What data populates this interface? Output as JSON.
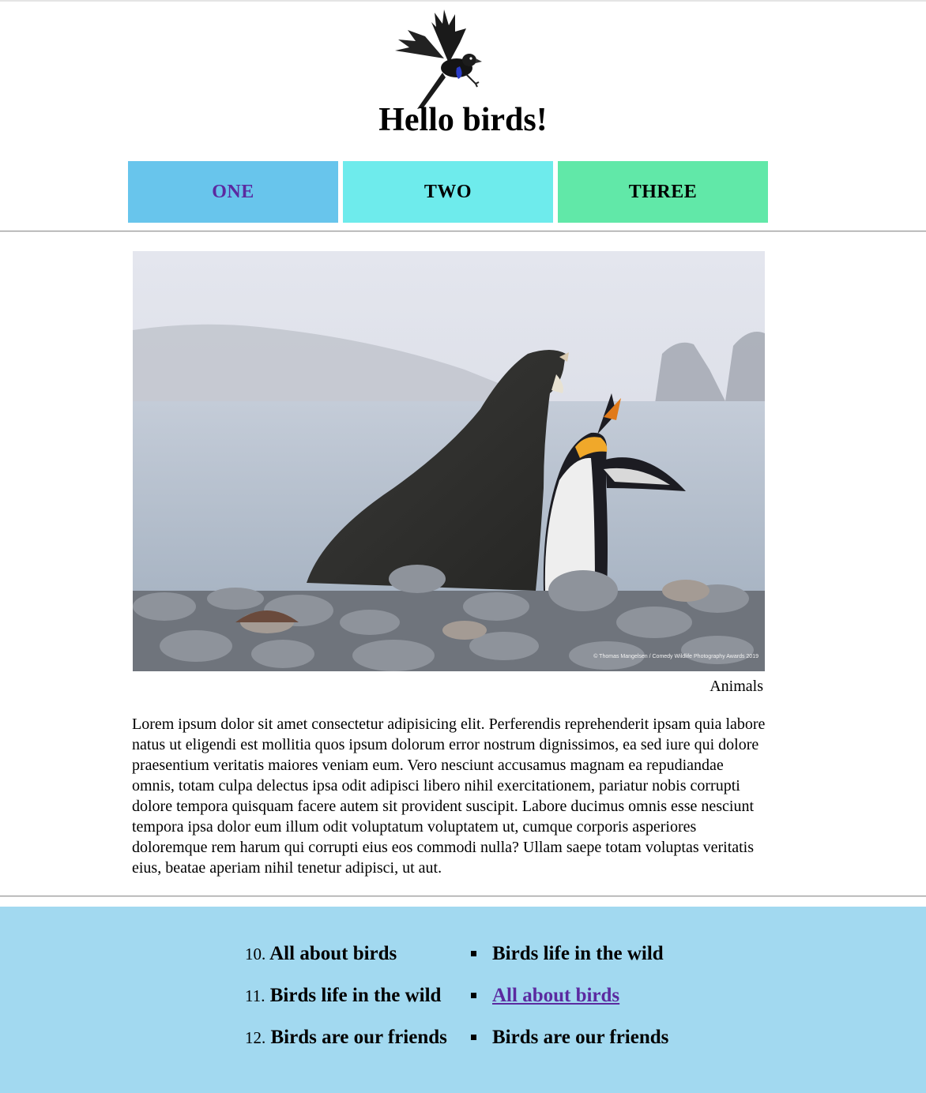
{
  "header": {
    "title": "Hello birds!",
    "logo_icon": "flying-bird-logo-icon"
  },
  "nav": {
    "items": [
      {
        "label": "ONE",
        "color": "#68c5ec",
        "visited": true
      },
      {
        "label": "TWO",
        "color": "#6eebec"
      },
      {
        "label": "THREE",
        "color": "#61e8a8"
      }
    ]
  },
  "main": {
    "image_icon": "seal-and-penguin-photo",
    "image_credit": "© Thomas Mangelsen / Comedy Wildlife Photography Awards 2019",
    "caption": "Animals",
    "paragraph": "Lorem ipsum dolor sit amet consectetur adipisicing elit. Perferendis reprehenderit ipsam quia labore natus ut eligendi est mollitia quos ipsum dolorum error nostrum dignissimos, ea sed iure qui dolore praesentium veritatis maiores veniam eum. Vero nesciunt accusamus magnam ea repudiandae omnis, totam culpa delectus ipsa odit adipisci libero nihil exercitationem, pariatur nobis corrupti dolore tempora quisquam facere autem sit provident suscipit. Labore ducimus omnis esse nesciunt tempora ipsa dolor eum illum odit voluptatum voluptatem ut, cumque corporis asperiores doloremque rem harum qui corrupti eius eos commodi nulla? Ullam saepe totam voluptas veritatis eius, beatae aperiam nihil tenetur adipisci, ut aut."
  },
  "footer": {
    "background": "#a2d9f0",
    "ordered": [
      {
        "num": "10.",
        "label": "All about birds"
      },
      {
        "num": "11.",
        "label": "Birds life in the wild"
      },
      {
        "num": "12.",
        "label": "Birds are our friends"
      }
    ],
    "unordered": [
      {
        "label": "Birds life in the wild"
      },
      {
        "label": "All about birds",
        "link": true
      },
      {
        "label": "Birds are our friends"
      }
    ]
  }
}
